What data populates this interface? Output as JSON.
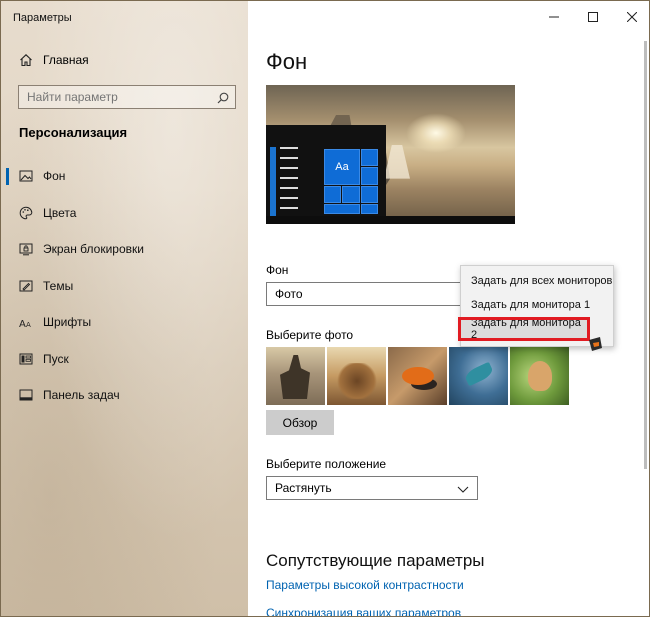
{
  "window": {
    "title": "Параметры"
  },
  "sidebar": {
    "home_label": "Главная",
    "search_placeholder": "Найти параметр",
    "section_title": "Персонализация",
    "items": [
      {
        "label": "Фон",
        "icon": "picture-icon",
        "active": true
      },
      {
        "label": "Цвета",
        "icon": "palette-icon",
        "active": false
      },
      {
        "label": "Экран блокировки",
        "icon": "lock-screen-icon",
        "active": false
      },
      {
        "label": "Темы",
        "icon": "themes-icon",
        "active": false
      },
      {
        "label": "Шрифты",
        "icon": "fonts-icon",
        "active": false
      },
      {
        "label": "Пуск",
        "icon": "start-icon",
        "active": false
      },
      {
        "label": "Панель задач",
        "icon": "taskbar-icon",
        "active": false
      }
    ]
  },
  "content": {
    "page_title": "Фон",
    "preview": {
      "tile_label": "Aa"
    },
    "background_label": "Фон",
    "background_value": "Фото",
    "choose_photo_label": "Выберите фото",
    "browse_button": "Обзор",
    "position_label": "Выберите положение",
    "position_value": "Растянуть",
    "related_title": "Сопутствующие параметры",
    "links": [
      "Параметры высокой контрастности",
      "Синхронизация ваших параметров"
    ]
  },
  "context_menu": {
    "items": [
      "Задать для всех мониторов",
      "Задать для монитора 1",
      "Задать для монитора 2"
    ],
    "highlighted_index": 2
  },
  "colors": {
    "accent": "#0063b1",
    "highlight_border": "#e11b22"
  }
}
